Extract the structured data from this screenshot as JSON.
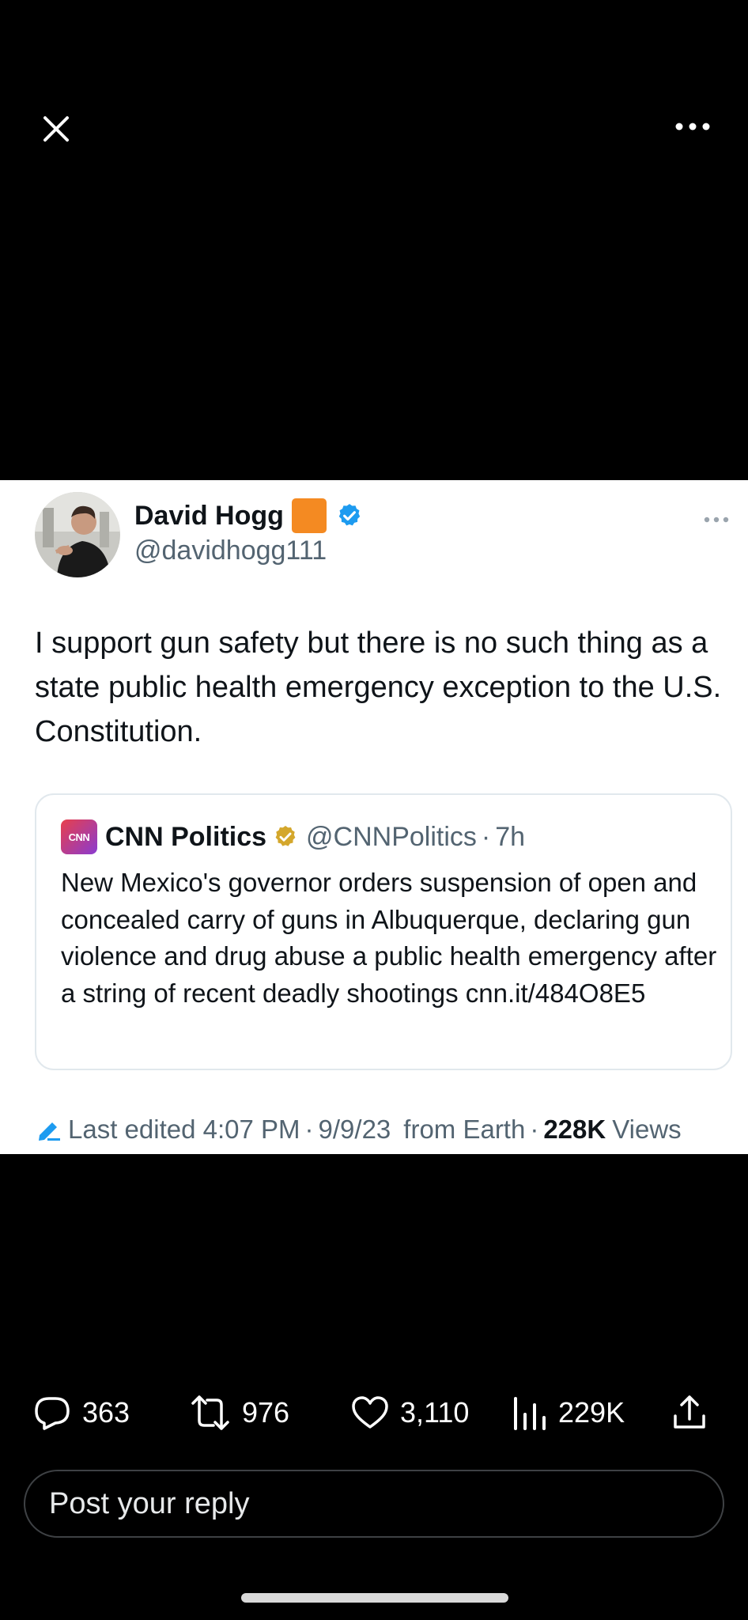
{
  "tweet": {
    "display_name": "David Hogg",
    "handle": "@davidhogg111",
    "text": "I support gun safety but there is no such thing as a state public health emergency exception to the U.S. Constitution.",
    "colors": {
      "verified": "#1d9bf0",
      "orange_emoji": "#f48a22"
    }
  },
  "quote": {
    "logo_text": "CNN",
    "display_name": "CNN Politics",
    "handle": "@CNNPolitics",
    "dot": "·",
    "time": "7h",
    "text": "New Mexico's governor orders suspension of open and concealed carry of guns in Albuquerque, declaring gun violence and drug abuse a public health emergency after a string of recent deadly shootings cnn.it/484O8E5",
    "colors": {
      "gold_badge": "#d4a72c"
    }
  },
  "meta": {
    "edited": "Last edited 4:07 PM",
    "sep1": "·",
    "date": "9/9/23",
    "source": "from Earth",
    "sep2": "·",
    "views_count": "228K",
    "views_label": "Views"
  },
  "actions": {
    "replies": "363",
    "reposts": "976",
    "likes": "3,110",
    "views": "229K"
  },
  "reply": {
    "placeholder": "Post your reply"
  },
  "icons": [
    "close-icon",
    "more-icon",
    "verified-badge-icon",
    "pencil-icon",
    "reply-icon",
    "repost-icon",
    "like-icon",
    "views-icon",
    "share-icon"
  ]
}
